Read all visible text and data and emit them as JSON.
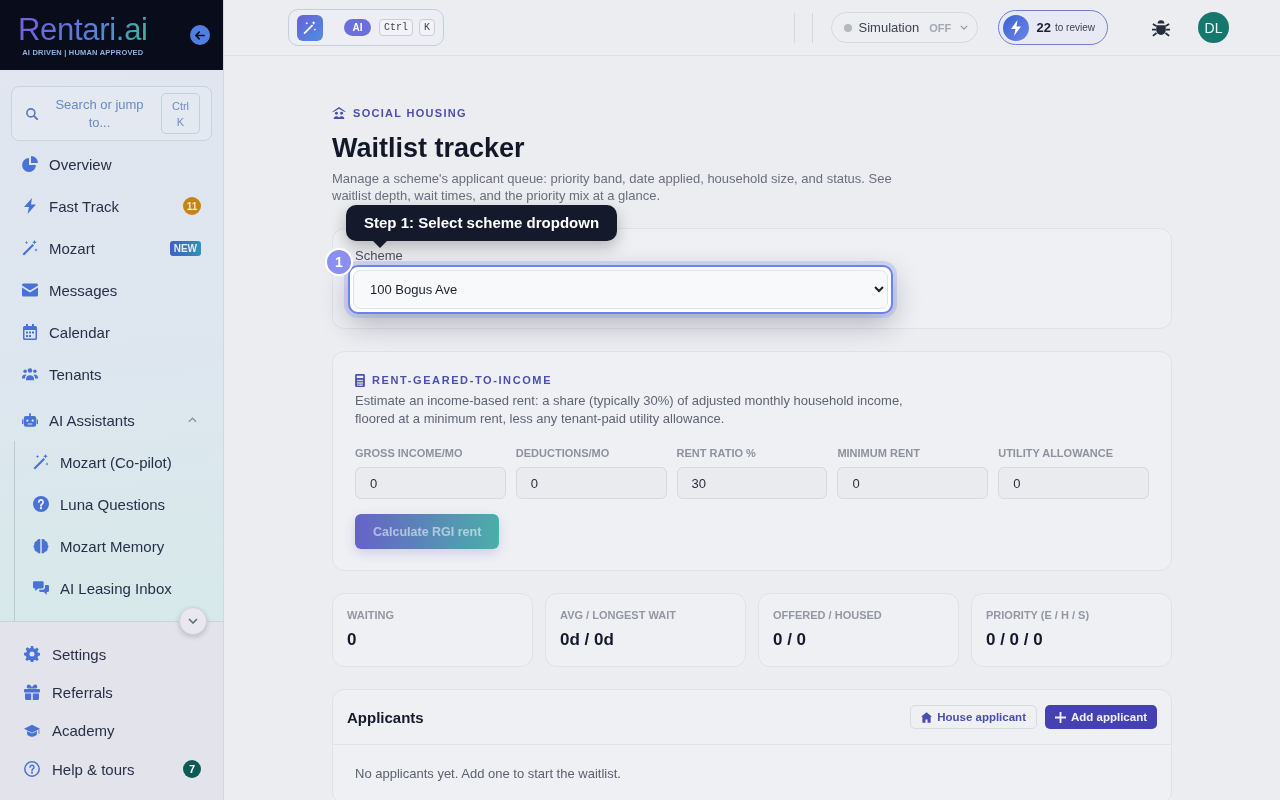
{
  "sidebar": {
    "logo": {
      "name": "Rentari.ai",
      "tagline": "AI DRIVEN | HUMAN APPROVED"
    },
    "search": {
      "placeholder": "Search or jump to...",
      "shortcut": [
        "Ctrl",
        "K"
      ]
    },
    "nav": [
      {
        "label": "Overview",
        "selected": false
      },
      {
        "label": "Fast Track",
        "selected": false,
        "badge": {
          "text": "11",
          "kind": "alert"
        }
      },
      {
        "label": "Mozart",
        "selected": false,
        "badge": {
          "text": "NEW",
          "kind": "new"
        }
      },
      {
        "label": "Messages",
        "selected": false
      },
      {
        "label": "Calendar",
        "selected": false
      },
      {
        "label": "Tenants",
        "selected": false
      },
      {
        "label": "AI Assistants",
        "selected": false,
        "expanded": true,
        "children": [
          {
            "label": "Mozart (Co-pilot)",
            "selected": false
          },
          {
            "label": "Luna Questions",
            "selected": false
          },
          {
            "label": "Mozart Memory",
            "selected": false
          },
          {
            "label": "AI Leasing Inbox",
            "selected": false
          }
        ]
      }
    ],
    "footer_nav": [
      {
        "label": "Settings",
        "selected": false
      },
      {
        "label": "Referrals",
        "selected": false
      },
      {
        "label": "Academy",
        "selected": false
      },
      {
        "label": "Help & tours",
        "selected": false,
        "badge": {
          "text": "7",
          "kind": "info"
        }
      }
    ]
  },
  "topbar": {
    "command": {
      "tag": "AI",
      "keys": [
        "Ctrl",
        "K"
      ]
    },
    "simulation": {
      "label": "Simulation",
      "state": "OFF",
      "on": false
    },
    "review": {
      "count": "22",
      "label": "to review"
    },
    "avatar": {
      "initials": "DL"
    }
  },
  "page": {
    "eyebrow": "SOCIAL HOUSING",
    "title": "Waitlist tracker",
    "description": "Manage a scheme's applicant queue: priority band, date applied, household size, and status. See waitlist depth, wait times, and the priority mix at a glance."
  },
  "scheme": {
    "label": "Scheme",
    "value": "100 Bogus Ave"
  },
  "tour": {
    "step": "1",
    "text": "Step 1: Select scheme dropdown"
  },
  "rgi": {
    "title": "RENT-GEARED-TO-INCOME",
    "description": "Estimate an income-based rent: a share (typically 30%) of adjusted monthly household income, floored at a minimum rent, less any tenant-paid utility allowance.",
    "fields": [
      {
        "label": "GROSS INCOME/MO",
        "value": "0"
      },
      {
        "label": "DEDUCTIONS/MO",
        "value": "0"
      },
      {
        "label": "RENT RATIO %",
        "value": "30"
      },
      {
        "label": "MINIMUM RENT",
        "value": "0"
      },
      {
        "label": "UTILITY ALLOWANCE",
        "value": "0"
      }
    ],
    "button": {
      "label": "Calculate RGI rent",
      "disabled": true
    }
  },
  "stats": [
    {
      "label": "WAITING",
      "value": "0"
    },
    {
      "label": "AVG / LONGEST WAIT",
      "value": "0d / 0d"
    },
    {
      "label": "OFFERED / HOUSED",
      "value": "0 / 0"
    },
    {
      "label": "PRIORITY (E / H / S)",
      "value": "0 / 0 / 0"
    }
  ],
  "applicants": {
    "title": "Applicants",
    "actions": [
      {
        "label": "House applicant",
        "kind": "secondary"
      },
      {
        "label": "Add applicant",
        "kind": "primary"
      }
    ],
    "empty": "No applicants yet. Add one to start the waitlist."
  }
}
